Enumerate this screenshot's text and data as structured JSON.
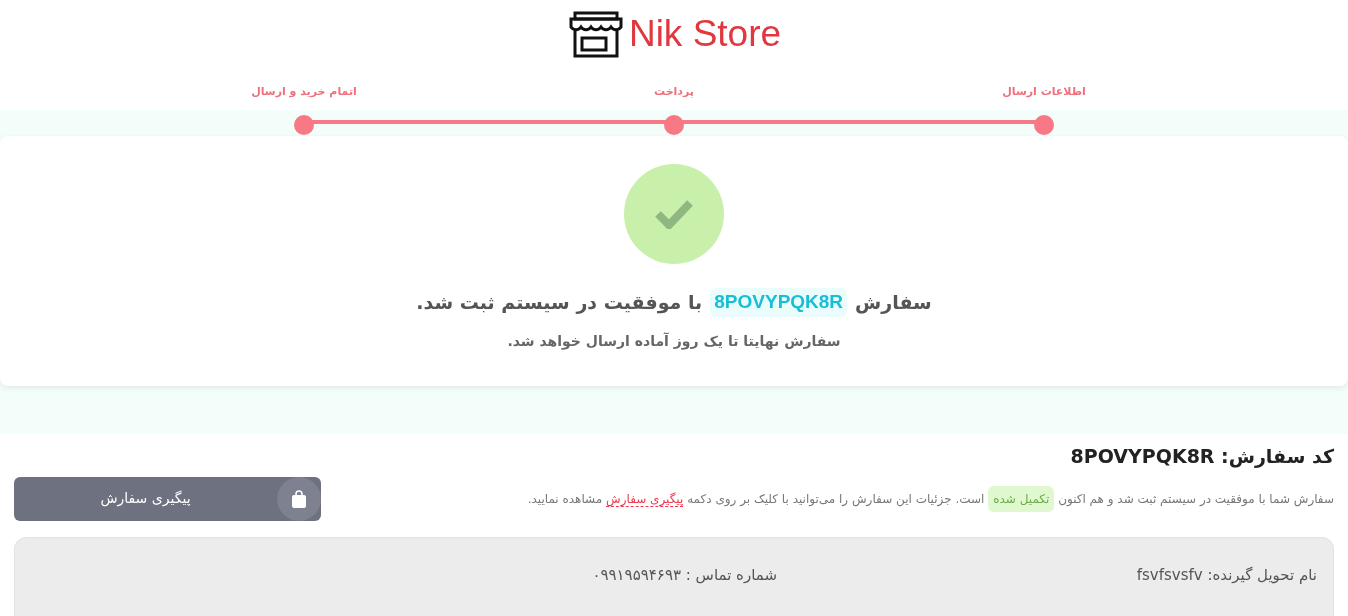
{
  "brand": {
    "name": "Nik Store"
  },
  "steps": [
    {
      "label": "اطلاعات ارسال",
      "completed": true
    },
    {
      "label": "پرداخت",
      "completed": true
    },
    {
      "label": "اتمام خرید و ارسال",
      "completed": true
    }
  ],
  "success": {
    "before": "سفارش",
    "code": "8POVYPQK8R",
    "after": "با موفقیت در سیستم ثبت شد.",
    "note": "سفارش نهایتا تا یک روز آماده ارسال خواهد شد."
  },
  "order": {
    "title": "کد سفارش: 8POVYPQK8R",
    "message_start": "سفارش شما با موفقیت در سیستم ثبت شد و هم اکنون",
    "status": "تکمیل شده",
    "message_middle": "است. جزئیات این سفارش را می‌توانید با کلیک بر روی دکمه",
    "link": "پیگیری سفارش",
    "message_end": "مشاهده نمایید.",
    "button": "پیگیری سفارش"
  },
  "details": {
    "recipient": "نام تحویل گیرنده: fsvfsvsfv",
    "phone": "شماره تماس : ۰۹۹۱۹۵۹۴۶۹۳"
  }
}
